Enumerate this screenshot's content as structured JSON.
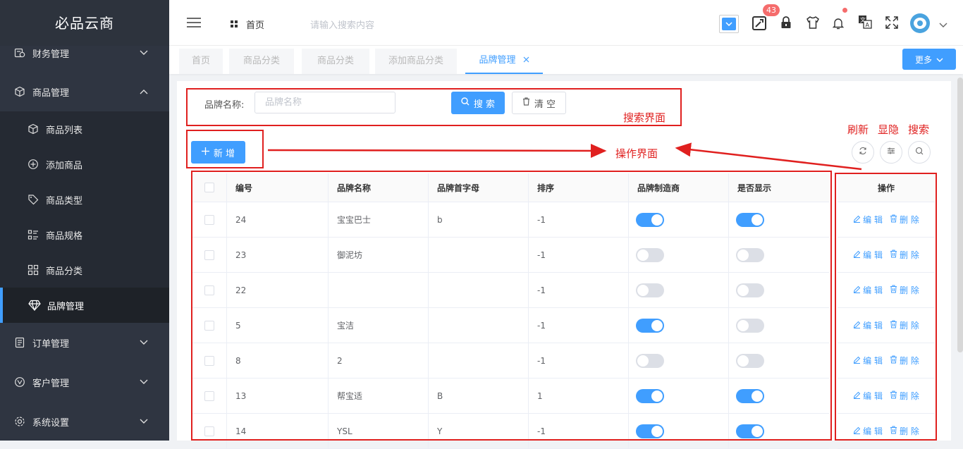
{
  "app": {
    "logo": "必品云商"
  },
  "sidebar": {
    "items": [
      {
        "label": "财务管理",
        "icon": "finance-icon"
      },
      {
        "label": "商品管理",
        "icon": "box-icon"
      },
      {
        "label": "商品列表",
        "icon": "cube-icon"
      },
      {
        "label": "添加商品",
        "icon": "plus-circle-icon"
      },
      {
        "label": "商品类型",
        "icon": "tag-icon"
      },
      {
        "label": "商品规格",
        "icon": "list-icon"
      },
      {
        "label": "商品分类",
        "icon": "grid-icon"
      },
      {
        "label": "品牌管理",
        "icon": "diamond-icon"
      },
      {
        "label": "订单管理",
        "icon": "order-icon"
      },
      {
        "label": "客户管理",
        "icon": "customer-icon"
      },
      {
        "label": "系统设置",
        "icon": "gear-icon"
      }
    ]
  },
  "header": {
    "breadcrumb": "首页",
    "search_placeholder": "请输入搜索内容",
    "notification_badge": "43"
  },
  "tabs": {
    "items": [
      "首页",
      "商品分类",
      "商品分类",
      "添加商品分类",
      "品牌管理"
    ],
    "more_label": "更多"
  },
  "search": {
    "label": "品牌名称:",
    "placeholder": "品牌名称",
    "search_button": "搜 索",
    "clear_button": "清 空"
  },
  "toolbar": {
    "add_button": "新 增"
  },
  "annotations": {
    "search_area": "搜索界面",
    "operation_area": "操作界面",
    "refresh": "刷新",
    "toggle": "显隐",
    "search": "搜索"
  },
  "table": {
    "headers": [
      "编号",
      "品牌名称",
      "品牌首字母",
      "排序",
      "品牌制造商",
      "是否显示"
    ],
    "rows": [
      {
        "id": "24",
        "name": "宝宝巴士",
        "letter": "b",
        "sort": "-1",
        "maker": true,
        "show": true
      },
      {
        "id": "23",
        "name": "御泥坊",
        "letter": "",
        "sort": "-1",
        "maker": false,
        "show": false
      },
      {
        "id": "22",
        "name": "",
        "letter": "",
        "sort": "-1",
        "maker": false,
        "show": false
      },
      {
        "id": "5",
        "name": "宝洁",
        "letter": "",
        "sort": "-1",
        "maker": true,
        "show": false
      },
      {
        "id": "8",
        "name": "2",
        "letter": "",
        "sort": "-1",
        "maker": false,
        "show": false
      },
      {
        "id": "13",
        "name": "帮宝适",
        "letter": "B",
        "sort": "1",
        "maker": true,
        "show": true
      },
      {
        "id": "14",
        "name": "YSL",
        "letter": "Y",
        "sort": "-1",
        "maker": true,
        "show": true
      }
    ],
    "ops_header": "操作",
    "edit_label": "编 辑",
    "delete_label": "删 除"
  },
  "colors": {
    "primary": "#409eff",
    "annotation": "#e0201f",
    "sidebar": "#2f3541"
  }
}
